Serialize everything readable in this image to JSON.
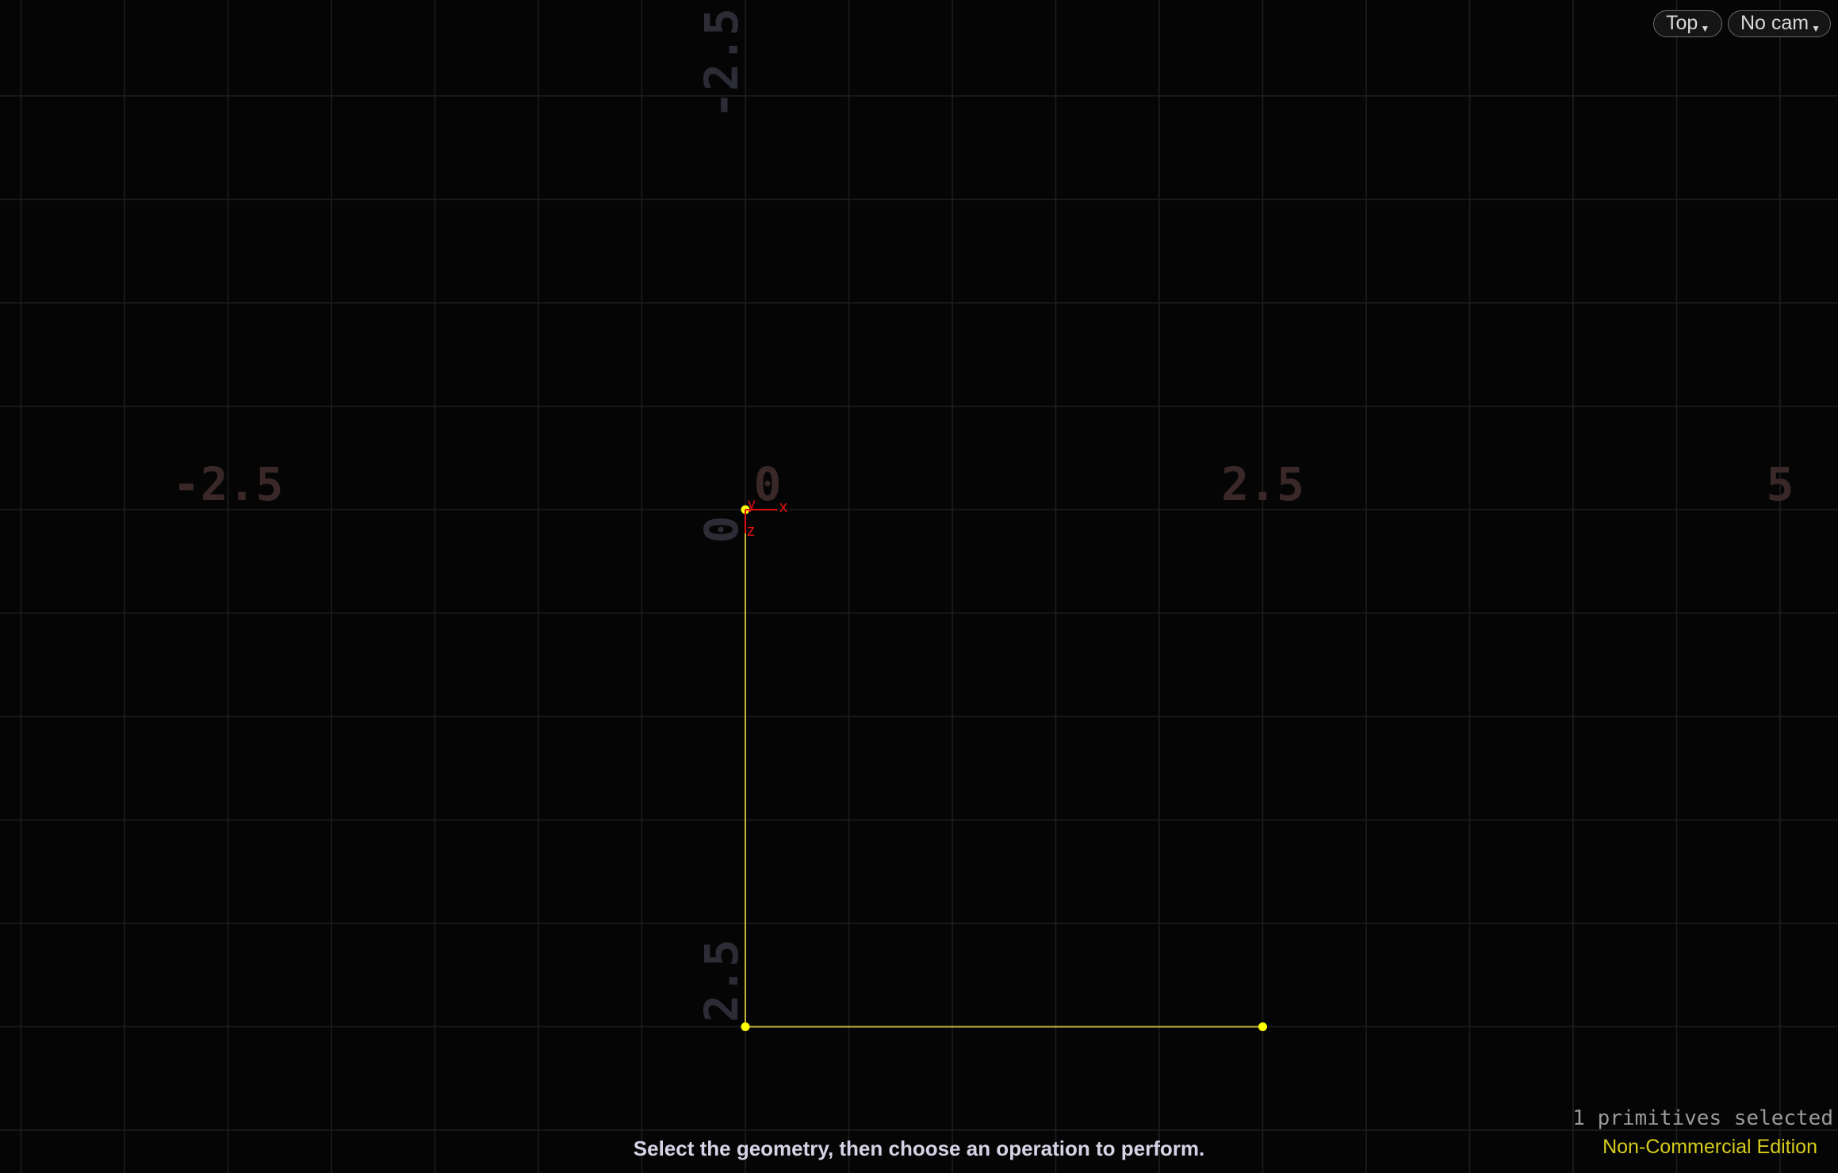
{
  "viewport": {
    "view_menu_label": "Top",
    "camera_menu_label": "No cam",
    "status_hint": "Select the geometry, then choose an operation to perform.",
    "selection_info": "1 primitives selected",
    "edition_label": "Non-Commercial Edition"
  },
  "grid": {
    "x_axis_labels": [
      "-2.5",
      "0",
      "2.5",
      "5"
    ],
    "z_axis_labels": [
      "-2.5",
      "0",
      "2.5"
    ],
    "x_axis_values": [
      -2.5,
      0,
      2.5,
      5
    ],
    "z_axis_values": [
      -2.5,
      0,
      2.5
    ],
    "line_spacing_units": 0.5,
    "x_label_color": "#3a2828",
    "z_label_color": "#2c2c36",
    "grid_line_color": "#1e1e1e"
  },
  "gnomon": {
    "x_label": "x",
    "y_label": "y",
    "z_label": "z",
    "color": "#e01010"
  },
  "geometry": {
    "curve_color": "#c8b43a",
    "point_color": "#ffff00",
    "points": [
      {
        "x": 0,
        "z": 0
      },
      {
        "x": 0,
        "z": 2.5
      },
      {
        "x": 2.5,
        "z": 2.5
      }
    ]
  },
  "colors": {
    "background": "#050505",
    "status_text": "#d4d4e6",
    "edition_text": "#d6cc1e",
    "selection_text": "#9a9a9a"
  },
  "icons": {
    "view_menu_caret": "caret-down-icon",
    "camera_menu_caret": "caret-down-icon"
  }
}
